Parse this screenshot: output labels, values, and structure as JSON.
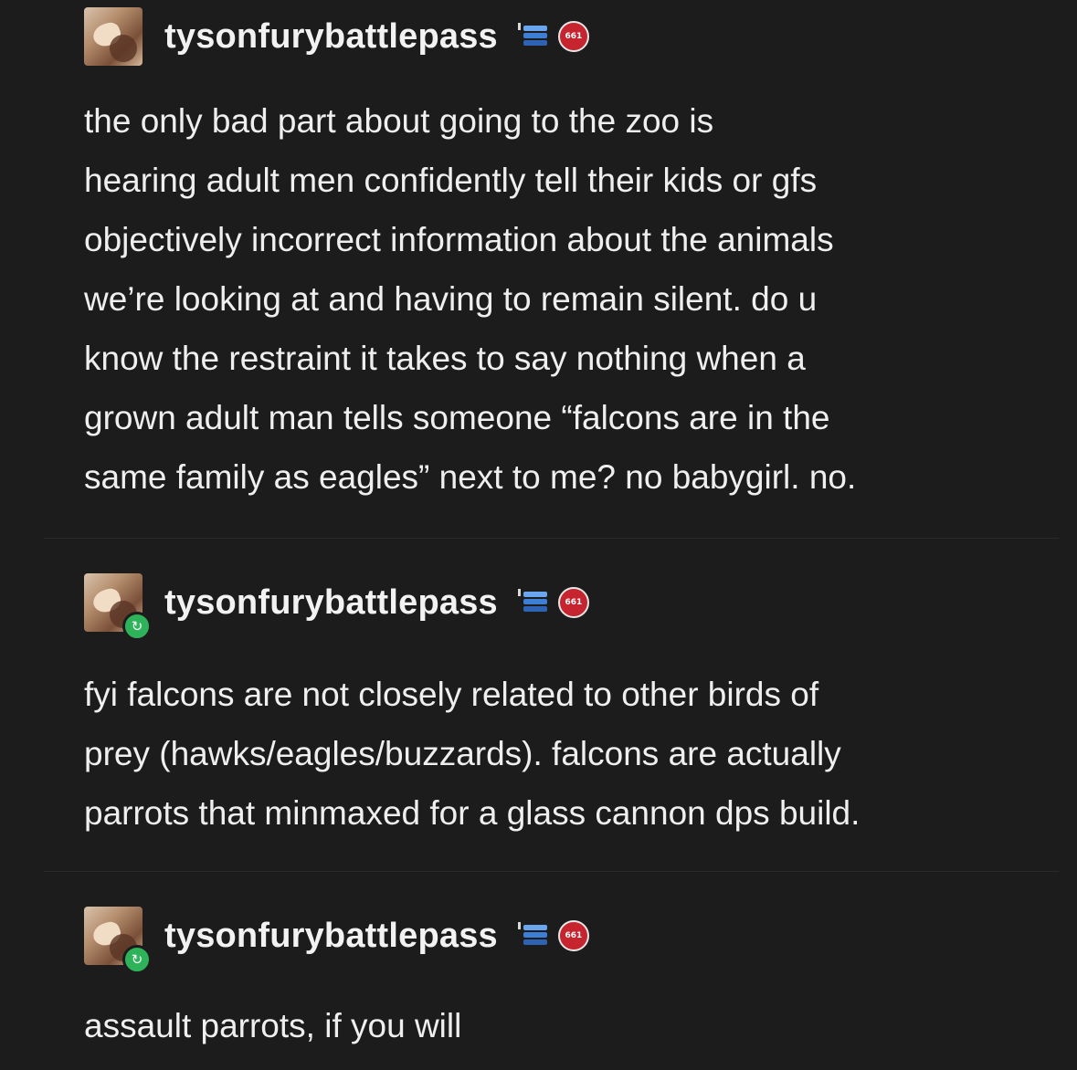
{
  "posts": [
    {
      "username": "tysonfurybattlepass",
      "is_reblog": false,
      "badge_text": "661",
      "body": "the only bad part about going to the zoo is\nhearing adult men confidently tell their kids or gfs\nobjectively incorrect information about the animals\nwe’re looking at and having to remain silent. do u\nknow the restraint it takes to say nothing when a\ngrown adult man tells someone “falcons are in the\nsame family as eagles” next to me? no babygirl. no."
    },
    {
      "username": "tysonfurybattlepass",
      "is_reblog": true,
      "badge_text": "661",
      "body": "fyi falcons are not closely related to other birds of\nprey (hawks/eagles/buzzards). falcons are actually\nparrots that minmaxed for a glass cannon dps build."
    },
    {
      "username": "tysonfurybattlepass",
      "is_reblog": true,
      "badge_text": "661",
      "body": "assault parrots, if you will"
    }
  ],
  "colors": {
    "background": "#1c1c1c",
    "text": "#efefef",
    "reblog_badge": "#2fb35a",
    "red_badge": "#c6242e",
    "blue_icon": "#3d7fd6"
  },
  "icons": {
    "reblog": "reblog-icon",
    "stack": "stack-badge-icon",
    "red_badge": "red-badge-icon"
  }
}
